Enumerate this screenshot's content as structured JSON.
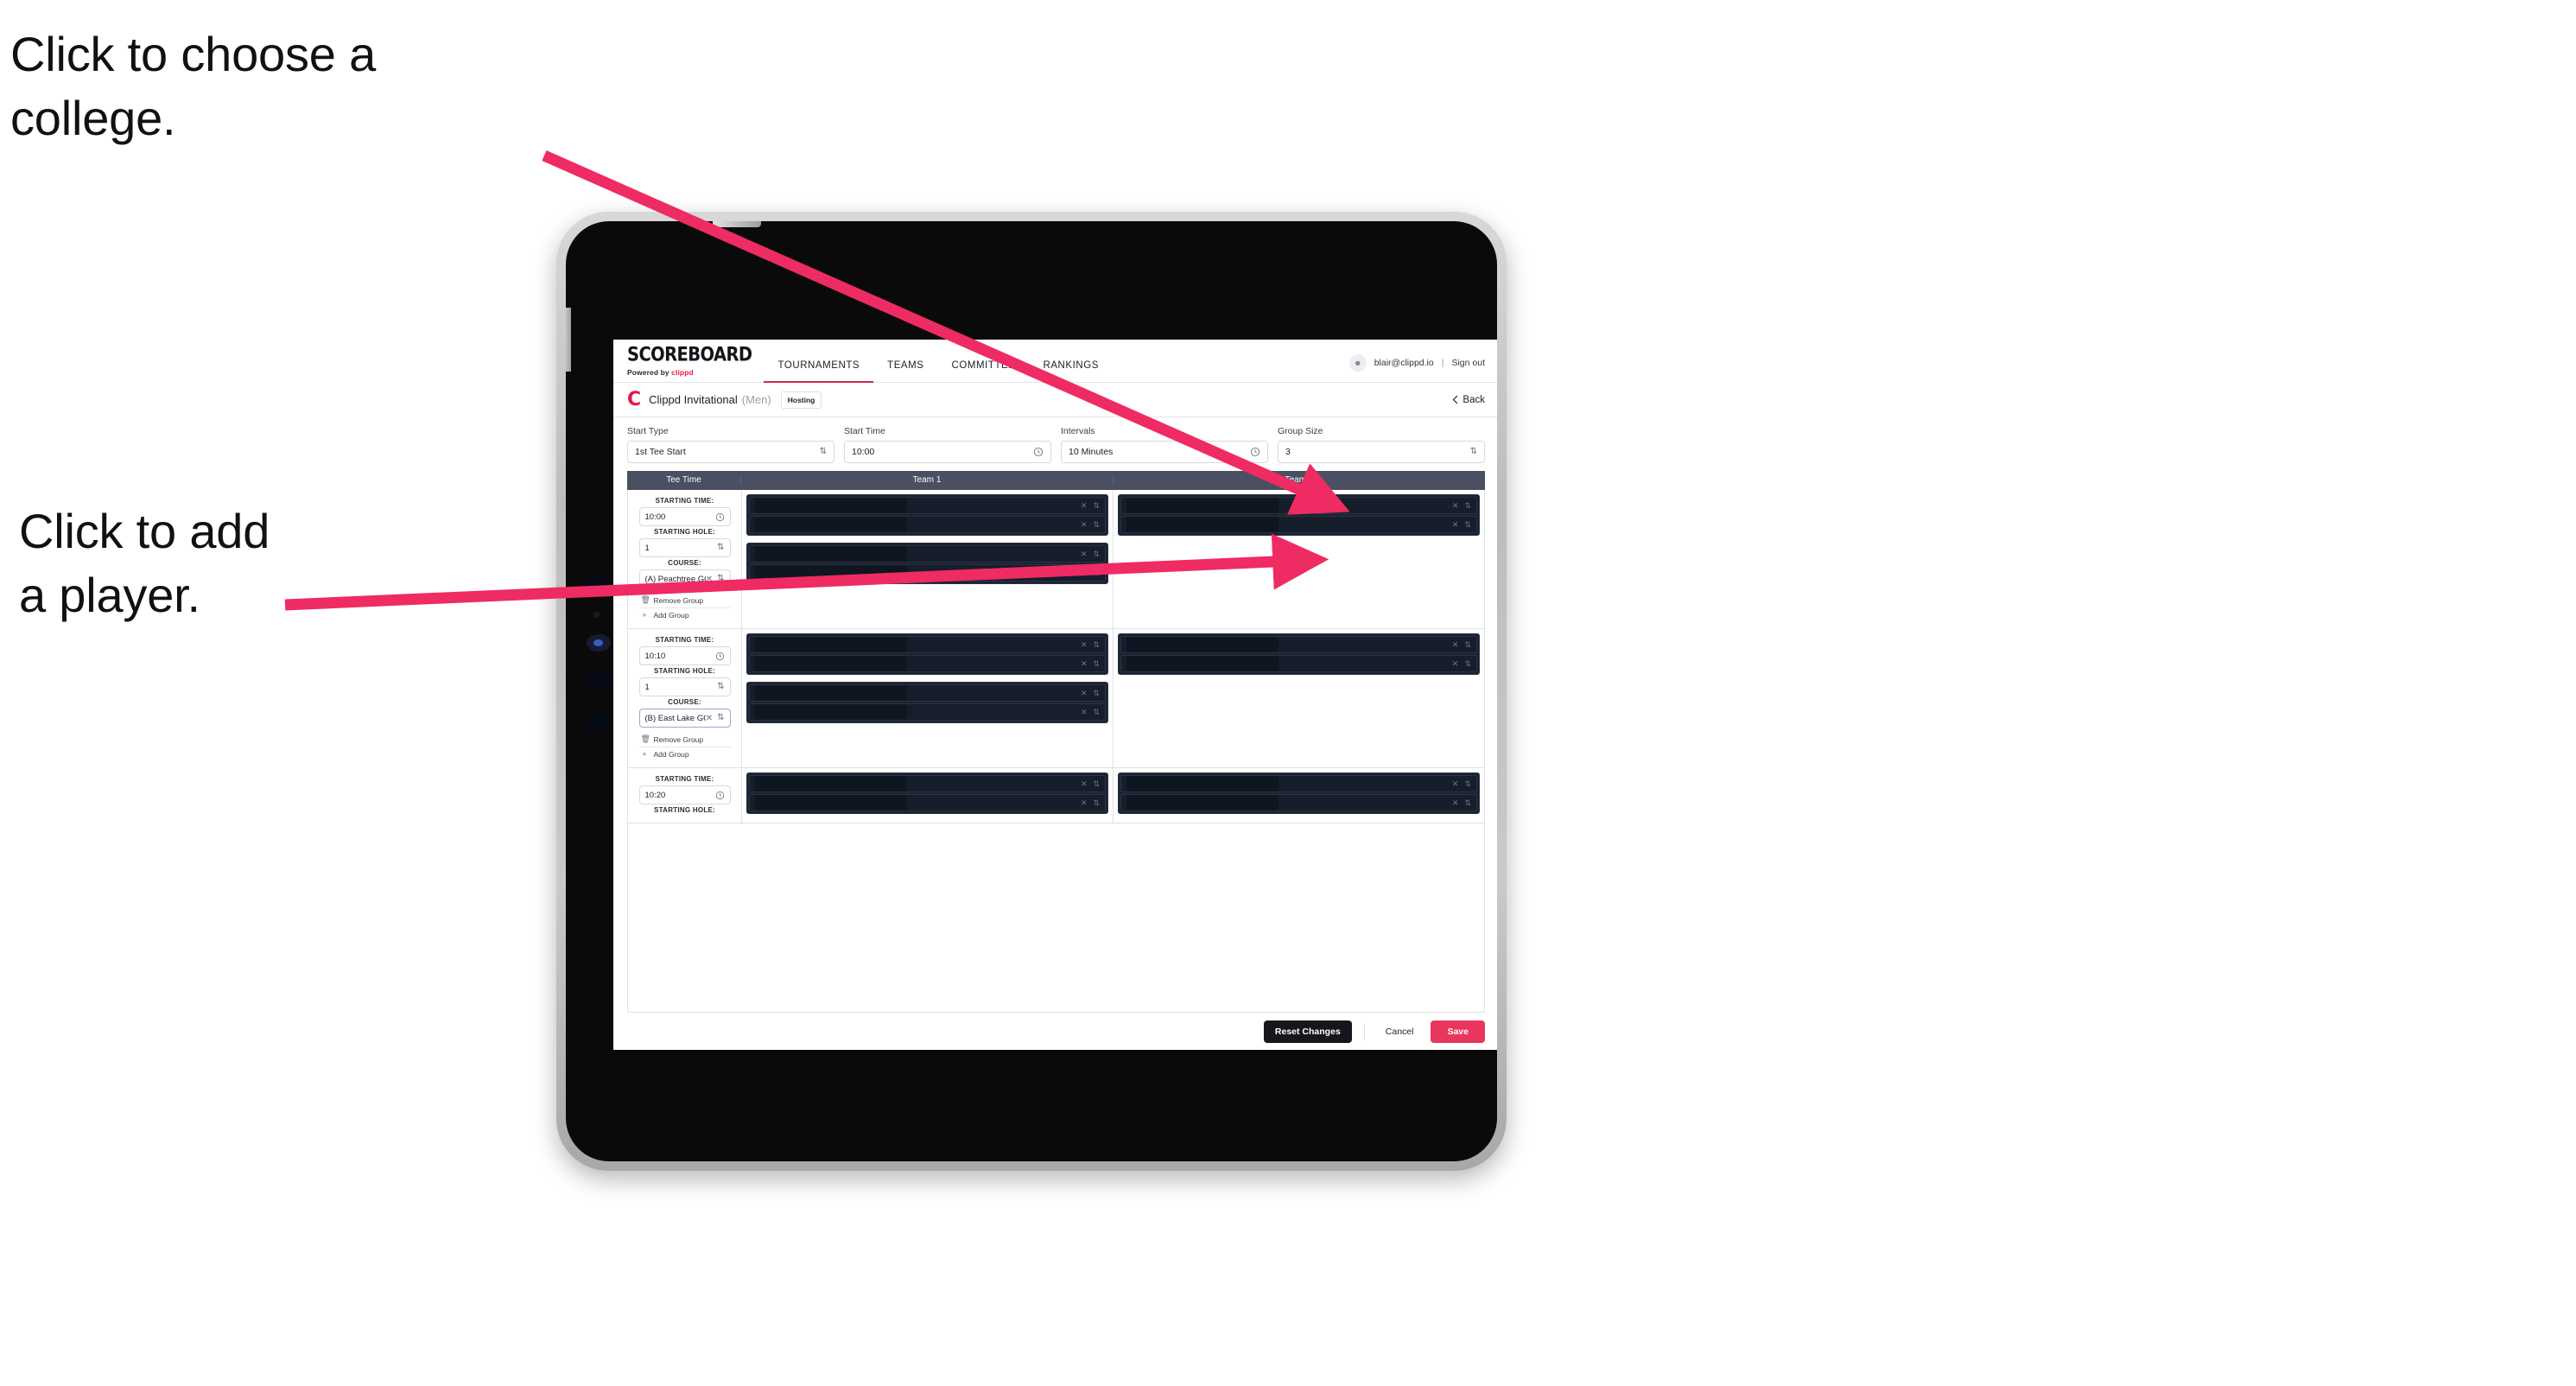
{
  "annotations": [
    {
      "id": "choose-college",
      "text": "Click to choose a\ncollege."
    },
    {
      "id": "add-player",
      "text": "Click to add\na player."
    }
  ],
  "colors": {
    "accent_pink": "#e8365d",
    "annotation_arrow": "#ef2b63",
    "table_header": "#4a5062",
    "slot_dark": "#161d2b",
    "active_tab_underline": "#c62a4d",
    "brand_red": "#e0194b"
  },
  "app": {
    "brand": {
      "word": "SCOREBOARD",
      "powered_prefix": "Powered by ",
      "powered_name": "clippd"
    },
    "nav": [
      {
        "label": "TOURNAMENTS",
        "active": true
      },
      {
        "label": "TEAMS",
        "active": false
      },
      {
        "label": "COMMITTEE",
        "active": false
      },
      {
        "label": "RANKINGS",
        "active": false
      }
    ],
    "account": {
      "avatar_icon": "user-icon",
      "email": "blair@clippd.io",
      "separator": "|",
      "sign_out": "Sign out"
    },
    "subheader": {
      "logo_letter": "C",
      "tournament_name": "Clippd Invitational",
      "gender": "(Men)",
      "badge": "Hosting",
      "back_label": "Back",
      "back_icon": "chevron-left-icon"
    },
    "controls": [
      {
        "label": "Start Type",
        "value": "1st Tee Start",
        "affordance": "stepper"
      },
      {
        "label": "Start Time",
        "value": "10:00",
        "affordance": "clock"
      },
      {
        "label": "Intervals",
        "value": "10 Minutes",
        "affordance": "clock"
      },
      {
        "label": "Group Size",
        "value": "3",
        "affordance": "stepper"
      }
    ],
    "table": {
      "columns": [
        "Tee Time",
        "Team 1",
        "Team 2"
      ],
      "labels": {
        "starting_time": "STARTING TIME:",
        "starting_hole": "STARTING HOLE:",
        "course": "COURSE:",
        "remove_group": "Remove Group",
        "add_group": "Add Group",
        "remove_icon": "trash-icon",
        "add_icon": "plus-icon",
        "clear_icon": "close-icon",
        "stepper_icon": "chevron-updown-icon",
        "clock_icon": "clock-icon"
      },
      "rows": [
        {
          "starting_time": "10:00",
          "starting_hole": "1",
          "course": "(A) Peachtree GC",
          "course_focused": false,
          "team1_groups": [
            2,
            2
          ],
          "team2_groups": [
            2
          ]
        },
        {
          "starting_time": "10:10",
          "starting_hole": "1",
          "course": "(B) East Lake GC",
          "course_focused": true,
          "team1_groups": [
            2,
            2
          ],
          "team2_groups": [
            2
          ]
        },
        {
          "starting_time": "10:20",
          "starting_hole": "",
          "course": "",
          "course_focused": false,
          "team1_groups": [
            2
          ],
          "team2_groups": [
            2
          ]
        }
      ]
    },
    "footer": {
      "reset": "Reset Changes",
      "cancel": "Cancel",
      "save": "Save"
    }
  }
}
